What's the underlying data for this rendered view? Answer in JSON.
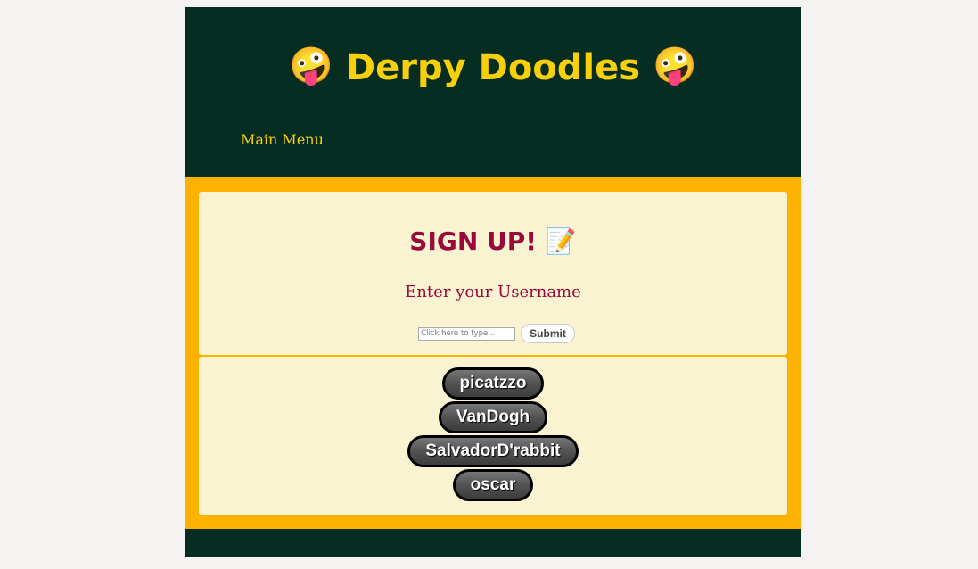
{
  "header": {
    "title": "Derpy Doodles",
    "emoji_left": "🤪",
    "emoji_right": "🤪",
    "nav_label": "Main Menu"
  },
  "signup": {
    "title": "SIGN UP!",
    "title_emoji": "📝",
    "prompt": "Enter your Username",
    "input_placeholder": "Click here to type...",
    "input_value": "",
    "submit_label": "Submit"
  },
  "users": [
    "picatzzo",
    "VanDogh",
    "SalvadorD'rabbit",
    "oscar"
  ],
  "colors": {
    "page_bg": "#f4f3f1",
    "header_bg": "#062d21",
    "title_yellow": "#f8cf0b",
    "band_orange": "#fdb200",
    "card_bg": "#faf3d1",
    "signup_red": "#99093b"
  }
}
